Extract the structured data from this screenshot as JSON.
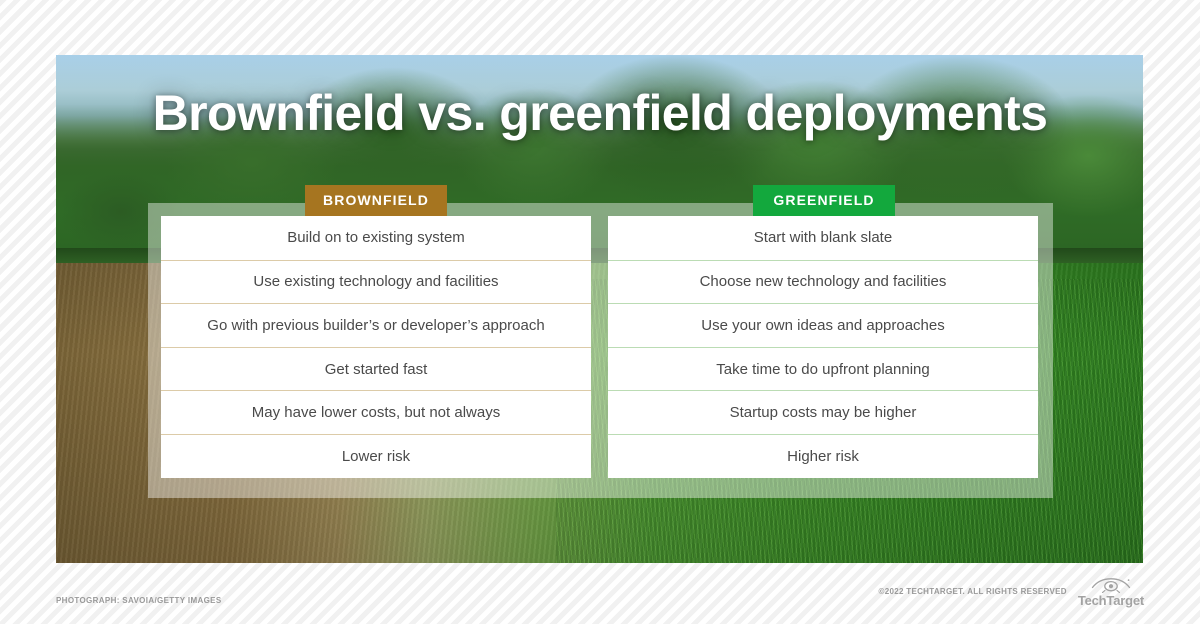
{
  "title": "Brownfield vs. greenfield deployments",
  "columns": [
    {
      "id": "brownfield",
      "header": "BROWNFIELD",
      "accent": "#a67520",
      "divider": "#dccba8",
      "rows": [
        "Build on to existing system",
        "Use existing technology and facilities",
        "Go with previous builder’s or developer’s approach",
        "Get started fast",
        "May have lower costs, but not always",
        "Lower risk"
      ]
    },
    {
      "id": "greenfield",
      "header": "GREENFIELD",
      "accent": "#13a83d",
      "divider": "#bbdcb4",
      "rows": [
        "Start with blank slate",
        "Choose new technology and facilities",
        "Use your own ideas and approaches",
        "Take time to do upfront planning",
        "Startup costs may be higher",
        "Higher risk"
      ]
    }
  ],
  "footer": {
    "photo_credit": "PHOTOGRAPH: SAVOIA/GETTY IMAGES",
    "copyright": "©2022 TECHTARGET. ALL RIGHTS RESERVED",
    "logo_word": "TechTarget",
    "logo_icon": "eye-icon"
  }
}
